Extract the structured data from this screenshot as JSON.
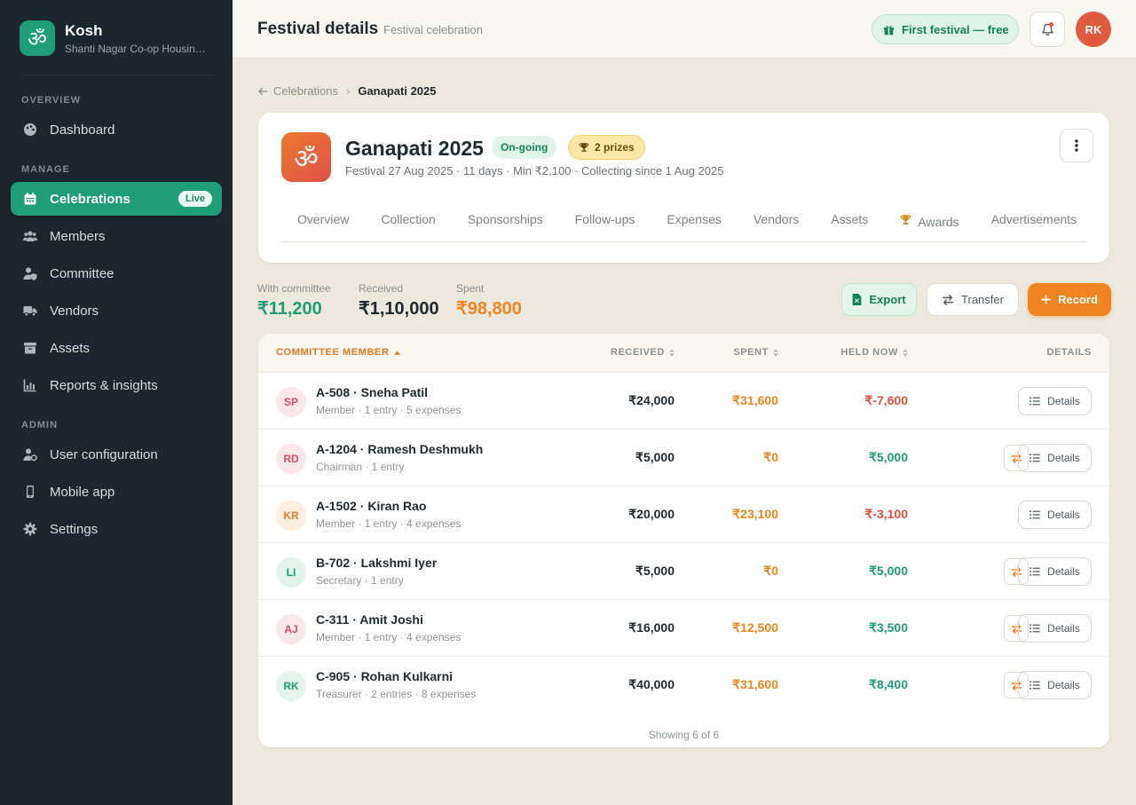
{
  "brand": {
    "name": "Kosh",
    "subtitle": "Shanti Nagar Co-op Housing Society",
    "logo_glyph": "ॐ",
    "color": "#1f9d76"
  },
  "sidebar": {
    "sections": {
      "overview": "OVERVIEW",
      "manage": "MANAGE",
      "admin": "ADMIN"
    },
    "items": [
      {
        "label": "Dashboard",
        "icon": "palette-icon"
      },
      {
        "label": "Celebrations",
        "icon": "calendar-icon",
        "badge": "Live",
        "active": true
      },
      {
        "label": "Members",
        "icon": "users-icon"
      },
      {
        "label": "Committee",
        "icon": "user-shield-icon"
      },
      {
        "label": "Vendors",
        "icon": "truck-icon"
      },
      {
        "label": "Assets",
        "icon": "archive-icon"
      },
      {
        "label": "Reports & insights",
        "icon": "bar-chart-icon"
      },
      {
        "label": "User configuration",
        "icon": "user-gear-icon"
      },
      {
        "label": "Mobile app",
        "icon": "mobile-icon"
      },
      {
        "label": "Settings",
        "icon": "gear-icon"
      }
    ]
  },
  "topbar": {
    "title": "Festival details",
    "subtitle": "Festival celebration",
    "promo": "First festival — free",
    "avatar": "RK"
  },
  "breadcrumb": {
    "parent": "Celebrations",
    "current": "Ganapati 2025"
  },
  "festival": {
    "glyph": "ॐ",
    "name": "Ganapati 2025",
    "status": "On-going",
    "prizes": "2 prizes",
    "meta": "Festival 27 Aug 2025 · 11 days · Min ₹2,100 · Collecting since 1 Aug 2025",
    "tabs": [
      "Overview",
      "Collection",
      "Sponsorships",
      "Follow-ups",
      "Expenses",
      "Vendors",
      "Assets",
      "Awards",
      "Advertisements"
    ]
  },
  "stats": {
    "committee": {
      "label": "With committee",
      "value": "₹11,200"
    },
    "received": {
      "label": "Received",
      "value": "₹1,10,000"
    },
    "spent": {
      "label": "Spent",
      "value": "₹98,800"
    }
  },
  "actions": {
    "export": "Export",
    "transfer": "Transfer",
    "record": "Record"
  },
  "table": {
    "headers": {
      "member": "COMMITTEE MEMBER",
      "received": "RECEIVED",
      "spent": "SPENT",
      "held": "HELD NOW",
      "details": "DETAILS"
    },
    "details_label": "Details",
    "rows": [
      {
        "initials": "SP",
        "name": "A-508 · Sneha Patil",
        "sub": "Member · 1 entry · 5 expenses",
        "received": "₹24,000",
        "spent": "₹31,600",
        "held": "₹-7,600",
        "held_positive": false,
        "transfer": false,
        "av_bg": "#fbe6ea",
        "av_fg": "#d0506a"
      },
      {
        "initials": "RD",
        "name": "A-1204 · Ramesh Deshmukh",
        "sub": "Chairman · 1 entry",
        "received": "₹5,000",
        "spent": "₹0",
        "held": "₹5,000",
        "held_positive": true,
        "transfer": true,
        "av_bg": "#fbe6ea",
        "av_fg": "#d0506a"
      },
      {
        "initials": "KR",
        "name": "A-1502 · Kiran Rao",
        "sub": "Member · 1 entry · 4 expenses",
        "received": "₹20,000",
        "spent": "₹23,100",
        "held": "₹-3,100",
        "held_positive": false,
        "transfer": false,
        "av_bg": "#fdeede",
        "av_fg": "#d9832a"
      },
      {
        "initials": "LI",
        "name": "B-702 · Lakshmi Iyer",
        "sub": "Secretary · 1 entry",
        "received": "₹5,000",
        "spent": "₹0",
        "held": "₹5,000",
        "held_positive": true,
        "transfer": true,
        "av_bg": "#e2f4ec",
        "av_fg": "#1f9d76"
      },
      {
        "initials": "AJ",
        "name": "C-311 · Amit Joshi",
        "sub": "Member · 1 entry · 4 expenses",
        "received": "₹16,000",
        "spent": "₹12,500",
        "held": "₹3,500",
        "held_positive": true,
        "transfer": true,
        "av_bg": "#fbe6ea",
        "av_fg": "#d0506a"
      },
      {
        "initials": "RK",
        "name": "C-905 · Rohan Kulkarni",
        "sub": "Treasurer · 2 entries · 8 expenses",
        "received": "₹40,000",
        "spent": "₹31,600",
        "held": "₹8,400",
        "held_positive": true,
        "transfer": true,
        "av_bg": "#e2f4ec",
        "av_fg": "#1f9d76"
      }
    ],
    "footer": "Showing 6 of 6"
  }
}
